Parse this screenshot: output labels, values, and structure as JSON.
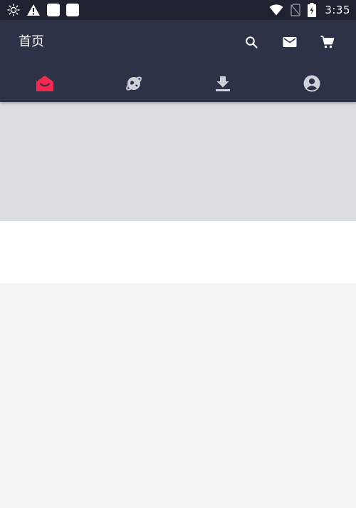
{
  "status_bar": {
    "time": "3:35",
    "left_icons": [
      "brightness-icon",
      "warning-icon",
      "notification-square-icon",
      "notification-square-icon"
    ],
    "right_icons": [
      "wifi-icon",
      "no-sim-icon",
      "battery-charging-icon"
    ]
  },
  "app_bar": {
    "title": "首页",
    "actions": [
      "search-icon",
      "mail-icon",
      "cart-icon"
    ],
    "tabs": [
      {
        "icon": "home-icon",
        "active": true
      },
      {
        "icon": "planet-icon",
        "active": false
      },
      {
        "icon": "download-icon",
        "active": false
      },
      {
        "icon": "account-icon",
        "active": false
      }
    ]
  },
  "colors": {
    "status_bar": "#1f2230",
    "app_bar": "#2e3247",
    "active_tab": "#f5294f",
    "inactive_tab": "#cfd1d8",
    "banner": "#d9dce1",
    "white_section": "#ffffff",
    "content_background": "#f3f4f6"
  }
}
